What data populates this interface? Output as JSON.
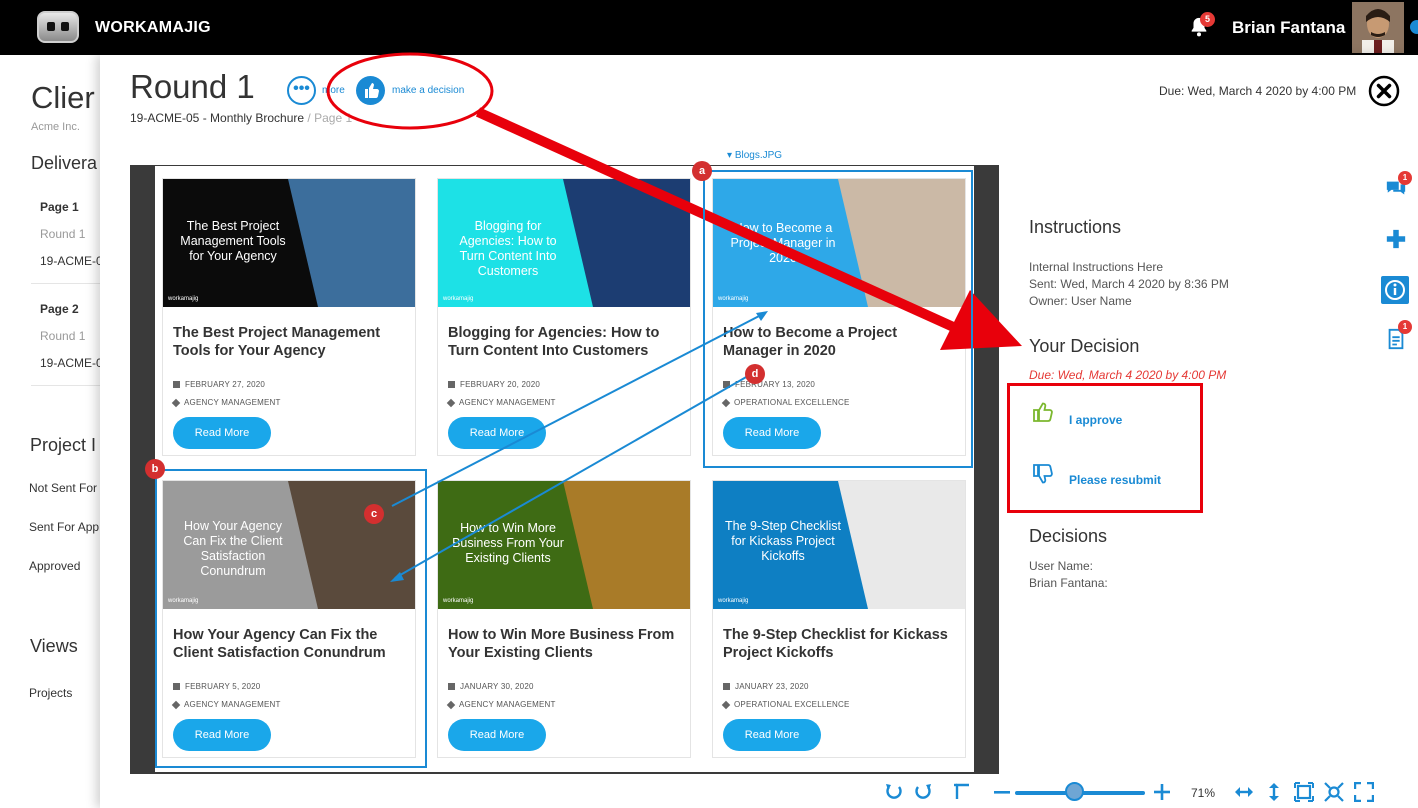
{
  "app": {
    "brand": "WORKAMAJIG",
    "notifications_count": "5",
    "user_name": "Brian Fantana"
  },
  "background": {
    "title": "Clier",
    "client": "Acme Inc.",
    "deliverables_heading": "Delivera",
    "pages": [
      {
        "name": "Page 1",
        "round": "Round 1",
        "code": "19-ACME-0"
      },
      {
        "name": "Page 2",
        "round": "Round 1",
        "code": "19-ACME-0"
      }
    ],
    "project_heading": "Project I",
    "statuses": [
      "Not Sent For",
      "Sent For App",
      "Approved"
    ],
    "views_heading": "Views",
    "views": [
      "Projects"
    ]
  },
  "modal": {
    "title": "Round 1",
    "more_label": "more",
    "decision_label": "make a decision",
    "breadcrumb_project": "19-ACME-05 - Monthly Brochure",
    "breadcrumb_sep": " / ",
    "breadcrumb_page": "Page 1",
    "due": "Due: Wed, March 4 2020 by 4:00 PM",
    "file_name": "Blogs.JPG"
  },
  "cards": [
    {
      "thumb_text": "The Best Project Management Tools for Your Agency",
      "title": "The Best Project Management Tools for Your Agency",
      "date": "FEBRUARY 27, 2020",
      "category": "AGENCY MANAGEMENT",
      "button": "Read More",
      "thumb_bg": "#0b0b0b",
      "thumb_accent": "#3c6e9c"
    },
    {
      "thumb_text": "Blogging for Agencies: How to Turn Content Into Customers",
      "title": "Blogging for Agencies: How to Turn Content Into Customers",
      "date": "FEBRUARY 20, 2020",
      "category": "AGENCY MANAGEMENT",
      "button": "Read More",
      "thumb_bg": "#1de1e6",
      "thumb_accent": "#1c3d72"
    },
    {
      "thumb_text": "How to Become a Project Manager in 2020",
      "title": "How to Become a Project Manager in 2020",
      "date": "FEBRUARY 13, 2020",
      "category": "OPERATIONAL EXCELLENCE",
      "button": "Read More",
      "thumb_bg": "#2ea8e8",
      "thumb_accent": "#cbb9a6"
    },
    {
      "thumb_text": "How Your Agency Can Fix the Client Satisfaction Conundrum",
      "title": "How Your Agency Can Fix the Client Satisfaction Conundrum",
      "date": "FEBRUARY 5, 2020",
      "category": "AGENCY MANAGEMENT",
      "button": "Read More",
      "thumb_bg": "#9b9b9b",
      "thumb_accent": "#5a4a3c"
    },
    {
      "thumb_text": "How to Win More Business From Your Existing Clients",
      "title": "How to Win More Business From Your Existing Clients",
      "date": "JANUARY 30, 2020",
      "category": "AGENCY MANAGEMENT",
      "button": "Read More",
      "thumb_bg": "#3e6b14",
      "thumb_accent": "#a97b28"
    },
    {
      "thumb_text": "The 9-Step Checklist for Kickass Project Kickoffs",
      "title": "The 9-Step Checklist for Kickass Project Kickoffs",
      "date": "JANUARY 23, 2020",
      "category": "OPERATIONAL EXCELLENCE",
      "button": "Read More",
      "thumb_bg": "#0e7fc3",
      "thumb_accent": "#e9e9e9"
    }
  ],
  "brand_watermark": "workamajig",
  "markup_pins": [
    "a",
    "b",
    "c",
    "d"
  ],
  "instructions": {
    "heading": "Instructions",
    "text": "Internal Instructions Here",
    "sent": "Sent: Wed, March 4 2020 by 8:36 PM",
    "owner": "Owner: User Name"
  },
  "your_decision": {
    "heading": "Your Decision",
    "due": "Due: Wed, March 4 2020 by 4:00 PM",
    "approve": "I approve",
    "resubmit": "Please resubmit"
  },
  "decisions": {
    "heading": "Decisions",
    "entries": [
      "User Name:",
      "Brian Fantana:"
    ]
  },
  "side_badges": {
    "comments": "1",
    "files": "1"
  },
  "toolbar": {
    "zoom": "71%",
    "zoom_fraction": 0.46
  },
  "colors": {
    "accent": "#1a8ad4",
    "annotation_red": "#e8000b",
    "approve_green": "#7cb82f",
    "button_blue": "#1aa7ea"
  }
}
